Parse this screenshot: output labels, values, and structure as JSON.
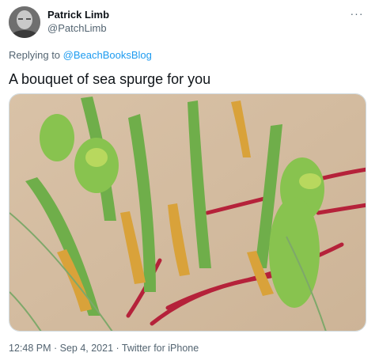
{
  "author": {
    "name": "Patrick Limb",
    "handle": "@PatchLimb"
  },
  "more_menu_glyph": "···",
  "reply": {
    "prefix": "Replying to ",
    "mention": "@BeachBooksBlog"
  },
  "tweet": {
    "text": "A bouquet of sea spurge for you",
    "timestamp": "12:48 PM · Sep 4, 2021 · Twitter for iPhone"
  },
  "colors": {
    "link": "#1d9bf0",
    "secondary_text": "#536471",
    "primary_text": "#0f1419",
    "border": "#cfd9de"
  }
}
